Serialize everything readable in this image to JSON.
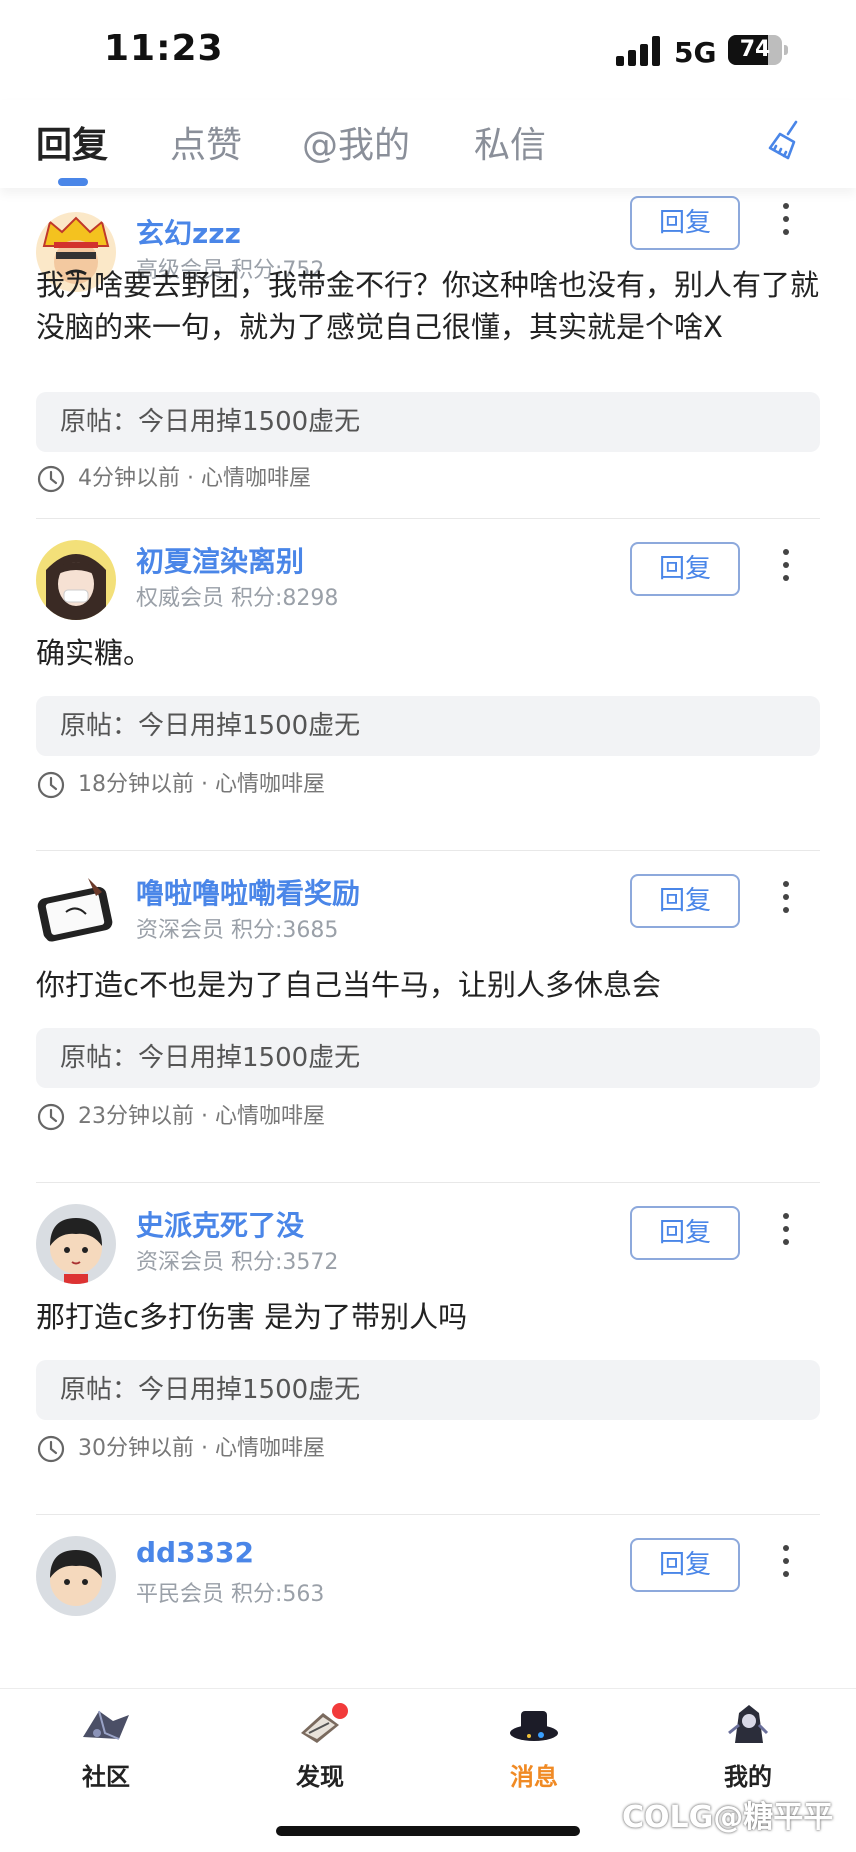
{
  "status_bar": {
    "time": "11:23",
    "network": "5G",
    "battery_level": "74",
    "battery_percent": 74
  },
  "tabs": [
    {
      "label": "回复",
      "active": true
    },
    {
      "label": "点赞",
      "active": false
    },
    {
      "label": "@我的",
      "active": false
    },
    {
      "label": "私信",
      "active": false
    }
  ],
  "icons": {
    "clear": "broom-icon",
    "more": "more-vertical-icon",
    "time": "clock-icon"
  },
  "colors": {
    "accent_blue": "#4a86e8",
    "active_nav": "#f08a24",
    "badge_red": "#f23b3b"
  },
  "messages": [
    {
      "user_name": "玄幻zzz",
      "level": "高级会员 积分:752",
      "reply_label": "回复",
      "content": "我为啥要去野团，我带金不行？你这种啥也没有，别人有了就没脑的来一句，就为了感觉自己很懂，其实就是个啥X",
      "quote": "原帖：今日用掉1500虚无",
      "meta": "4分钟以前 · 心情咖啡屋"
    },
    {
      "user_name": "初夏渲染离别",
      "level": "权威会员 积分:8298",
      "reply_label": "回复",
      "content": "确实糖。",
      "quote": "原帖：今日用掉1500虚无",
      "meta": "18分钟以前 · 心情咖啡屋"
    },
    {
      "user_name": "噜啦噜啦嘞看奖励",
      "level": "资深会员 积分:3685",
      "reply_label": "回复",
      "content": "你打造c不也是为了自己当牛马，让别人多休息会",
      "quote": "原帖：今日用掉1500虚无",
      "meta": "23分钟以前 · 心情咖啡屋"
    },
    {
      "user_name": "史派克死了没",
      "level": "资深会员 积分:3572",
      "reply_label": "回复",
      "content": "那打造c多打伤害 是为了带别人吗",
      "quote": "原帖：今日用掉1500虚无",
      "meta": "30分钟以前 · 心情咖啡屋"
    },
    {
      "user_name": "dd3332",
      "level": "平民会员 积分:563",
      "reply_label": "回复"
    }
  ],
  "bottom_nav": [
    {
      "label": "社区",
      "icon": "community-icon",
      "active": false
    },
    {
      "label": "发现",
      "icon": "discover-icon",
      "active": false,
      "badge": true
    },
    {
      "label": "消息",
      "icon": "message-icon",
      "active": true
    },
    {
      "label": "我的",
      "icon": "profile-icon",
      "active": false
    }
  ],
  "watermark": "COLG@糖平平"
}
